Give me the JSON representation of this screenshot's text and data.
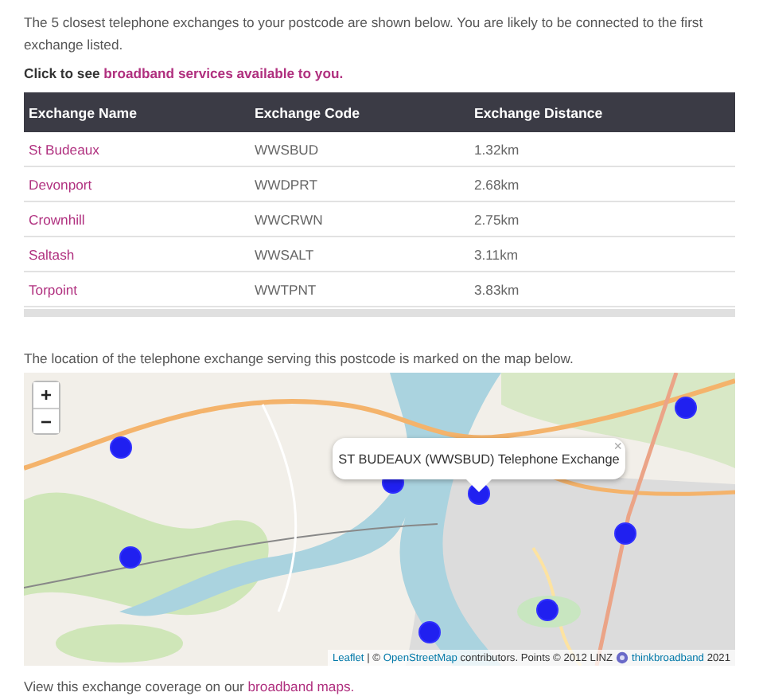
{
  "intro": "The 5 closest telephone exchanges to your postcode are shown below. You are likely to be connected to the first exchange listed.",
  "cta": {
    "prefix": "Click to see",
    "link": "broadband services available to you."
  },
  "table": {
    "columns": [
      "Exchange Name",
      "Exchange Code",
      "Exchange Distance"
    ],
    "rows": [
      {
        "name": "St Budeaux",
        "code": "WWSBUD",
        "distance": "1.32km"
      },
      {
        "name": "Devonport",
        "code": "WWDPRT",
        "distance": "2.68km"
      },
      {
        "name": "Crownhill",
        "code": "WWCRWN",
        "distance": "2.75km"
      },
      {
        "name": "Saltash",
        "code": "WWSALT",
        "distance": "3.11km"
      },
      {
        "name": "Torpoint",
        "code": "WWTPNT",
        "distance": "3.83km"
      }
    ]
  },
  "map_caption": "The location of the telephone exchange serving this postcode is marked on the map below.",
  "map": {
    "zoom_in": "+",
    "zoom_out": "−",
    "popup": {
      "text": "ST BUDEAUX (WWSBUD) Telephone Exchange",
      "close": "×"
    },
    "attribution": [
      {
        "kind": "link",
        "text": "Leaflet"
      },
      {
        "kind": "text",
        "text": " | © "
      },
      {
        "kind": "link",
        "text": "OpenStreetMap"
      },
      {
        "kind": "text",
        "text": " contributors. Points © 2012 LINZ"
      },
      {
        "kind": "icon"
      },
      {
        "kind": "link",
        "text": "thinkbroadband"
      },
      {
        "kind": "text",
        "text": " 2021"
      }
    ]
  },
  "footer": {
    "prefix": "View this exchange coverage on our",
    "link": "broadband maps."
  }
}
